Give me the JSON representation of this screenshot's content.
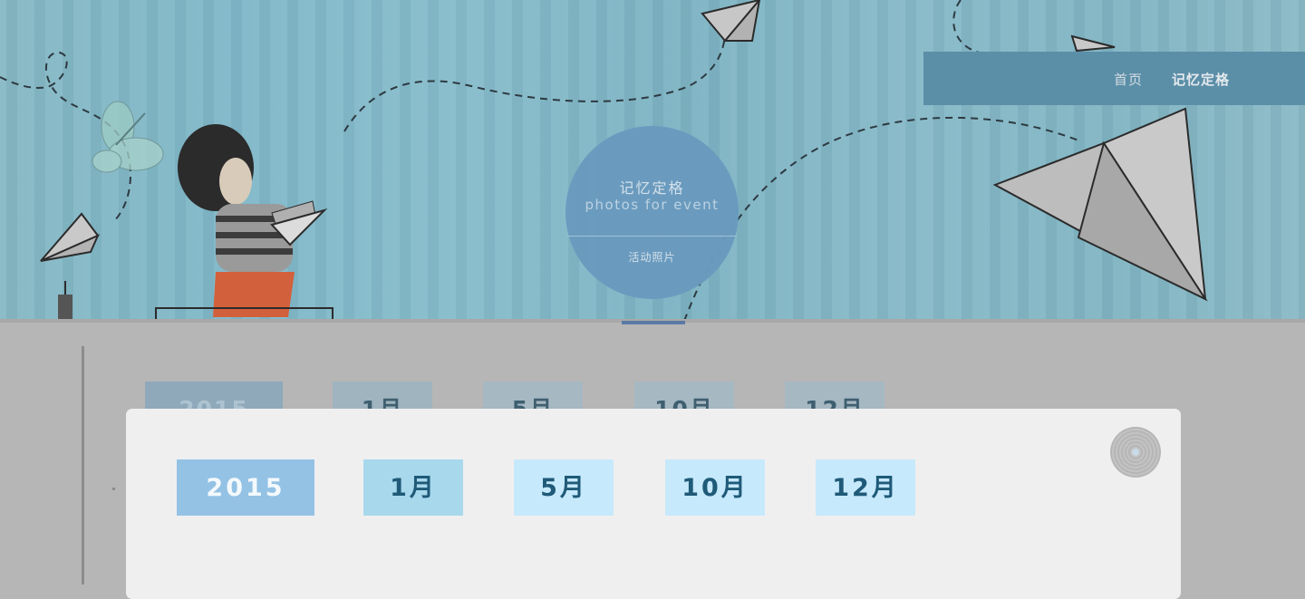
{
  "nav": {
    "items": [
      {
        "label": "首页"
      },
      {
        "label": "记忆定格"
      }
    ]
  },
  "hero": {
    "title": "记忆定格",
    "subtitle": "photos for event",
    "link_label": "活动照片"
  },
  "timeline": {
    "chips": [
      "2015",
      "1月",
      "5月",
      "10月",
      "12月"
    ],
    "visible_fragments": [
      "2015",
      "1月",
      "5月",
      "10月",
      "12月"
    ]
  },
  "modal": {
    "year": "2015",
    "months": [
      "1月",
      "5月",
      "10月",
      "12月"
    ],
    "close_icon": "close-icon"
  },
  "colors": {
    "nav_bg": "#5b8fa8",
    "circle_bg": "#6a9bbf",
    "chip_year_bg": "#93c2e5",
    "chip_month_bg": "#c6e9fb",
    "chip_text": "#1f5a78",
    "modal_bg": "#f0eff0",
    "overlay": "#b6b6b6"
  }
}
